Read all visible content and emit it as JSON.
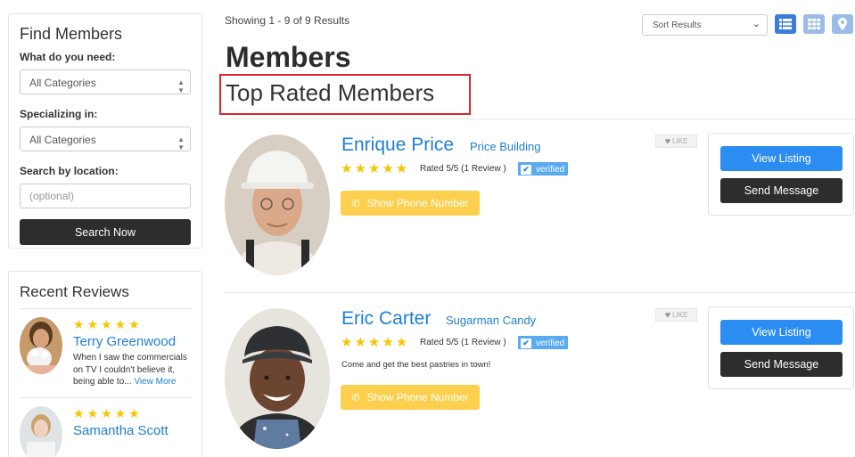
{
  "sidebar": {
    "find": {
      "title": "Find Members",
      "need_label": "What do you need:",
      "need_value": "All Categories",
      "special_label": "Specializing in:",
      "special_value": "All Categories",
      "location_label": "Search by location:",
      "location_placeholder": "(optional)",
      "search_button": "Search Now"
    },
    "reviews": {
      "title": "Recent Reviews",
      "items": [
        {
          "stars": "★★★★★",
          "name": "Terry Greenwood",
          "text": "When I saw the commercials on TV I couldn't believe it, being able to...",
          "more": "View More"
        },
        {
          "stars": "★★★★★",
          "name": "Samantha Scott"
        }
      ]
    }
  },
  "results": {
    "showing": "Showing 1 - 9 of 9 Results",
    "sort_placeholder": "Sort Results",
    "title": "Members",
    "subtitle": "Top Rated Members"
  },
  "members": [
    {
      "name": "Enrique Price",
      "company": "Price Building",
      "stars": "★★★★★",
      "rated": "Rated 5/5 (1 Review )",
      "verified": "verified",
      "phone": "Show Phone Number",
      "like": "LIKE",
      "view": "View Listing",
      "message": "Send Message"
    },
    {
      "name": "Eric Carter",
      "company": "Sugarman Candy",
      "stars": "★★★★★",
      "rated": "Rated 5/5 (1 Review )",
      "verified": "verified",
      "description": "Come and get the best pastries in town!",
      "phone": "Show Phone Number",
      "like": "LIKE",
      "view": "View Listing",
      "message": "Send Message"
    }
  ],
  "colors": {
    "link_blue": "#1f7fd1",
    "primary_button": "#2b8df2",
    "dark_button": "#2d2d2d",
    "phone_button": "#fcd04e",
    "star": "#f7c600",
    "highlight_border": "#d9262b"
  }
}
